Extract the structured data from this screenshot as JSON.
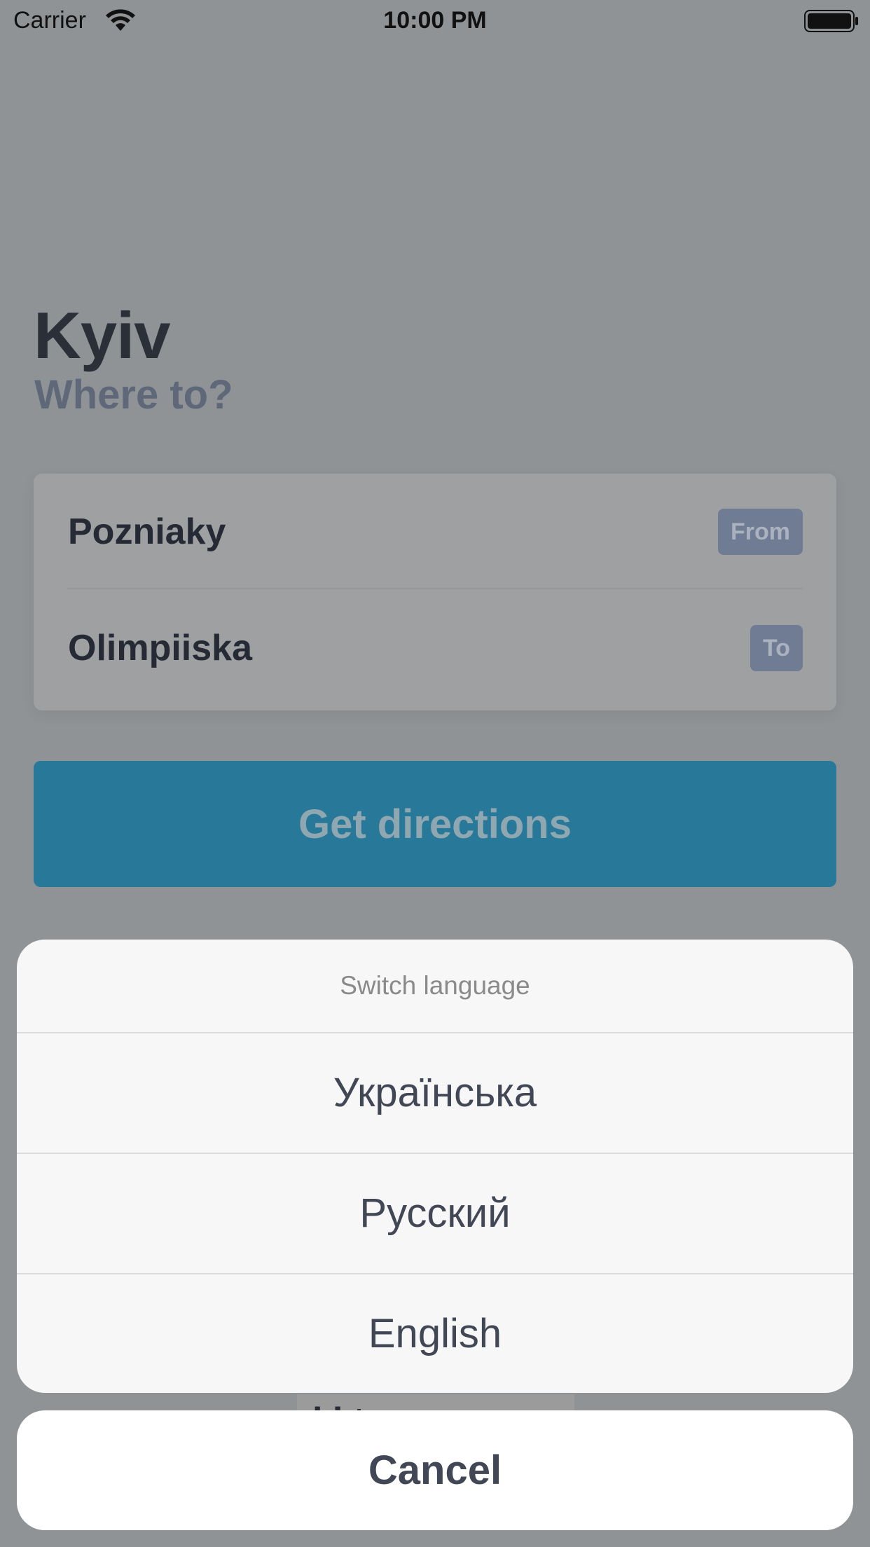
{
  "status_bar": {
    "carrier": "Carrier",
    "time": "10:00 PM"
  },
  "header": {
    "city": "Kyiv",
    "subtitle": "Where to?"
  },
  "route": {
    "from_station": "Pozniaky",
    "from_tag": "From",
    "to_station": "Olimpiiska",
    "to_tag": "To"
  },
  "actions": {
    "get_directions": "Get directions"
  },
  "action_sheet": {
    "title": "Switch language",
    "options": [
      {
        "label": "Українська"
      },
      {
        "label": "Русский"
      },
      {
        "label": "English"
      }
    ],
    "cancel": "Cancel"
  },
  "colors": {
    "accent": "#277899",
    "dim_overlay_bg": "#8f9396",
    "sheet_bg": "#f7f7f7",
    "tag_bg": "#6f7c93"
  }
}
